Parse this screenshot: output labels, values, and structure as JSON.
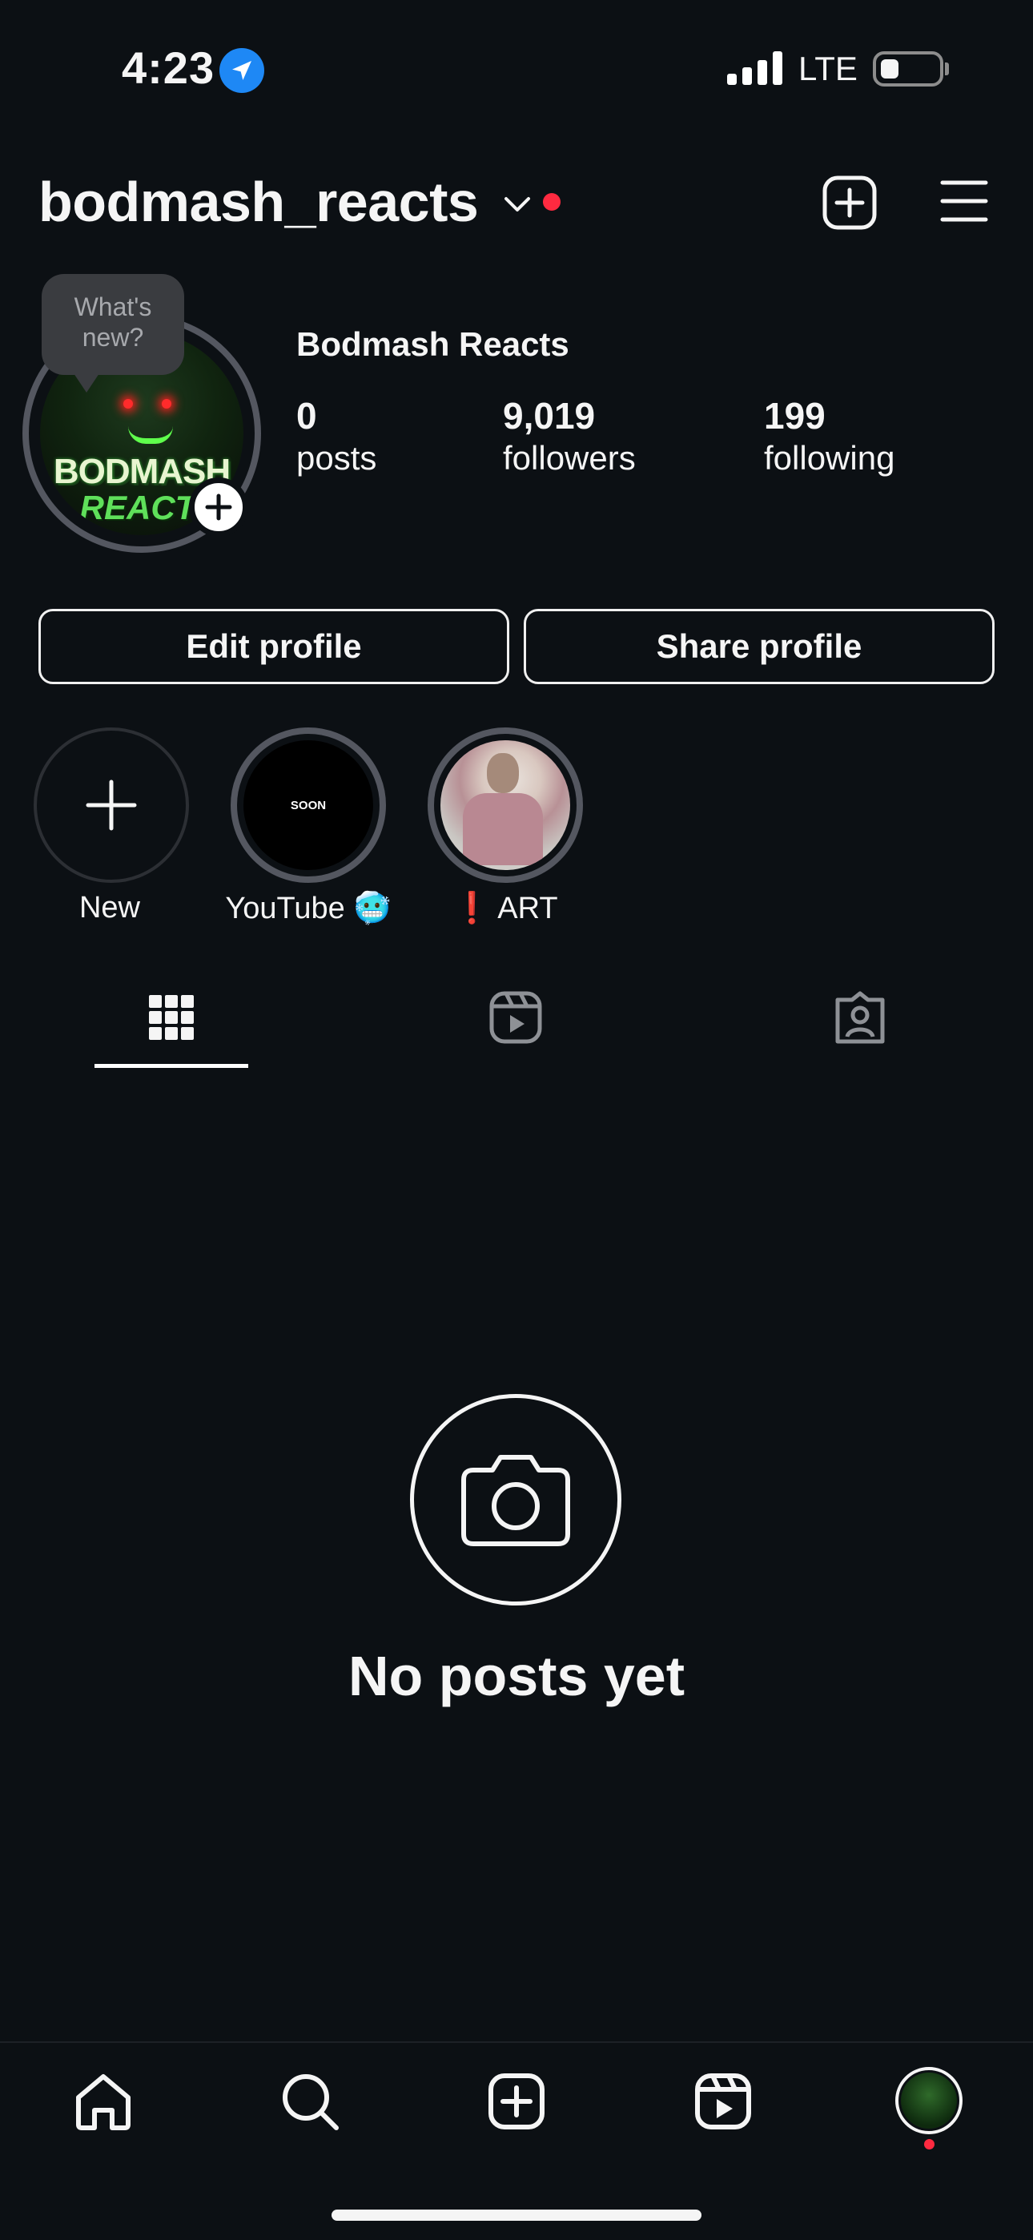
{
  "status_bar": {
    "time": "4:23",
    "network": "LTE"
  },
  "header": {
    "username": "bodmash_reacts",
    "icons": [
      "chevron-down-icon",
      "notification-dot",
      "new-post-icon",
      "menu-icon"
    ],
    "dot_color": "#ff2a40"
  },
  "profile": {
    "note_bubble": "What's new?",
    "display_name": "Bodmash Reacts",
    "avatar_text_line1": "BODMASH",
    "avatar_text_line2": "REACTS",
    "stats": [
      {
        "value": "0",
        "label": "posts"
      },
      {
        "value": "9,019",
        "label": "followers"
      },
      {
        "value": "199",
        "label": "following"
      }
    ]
  },
  "buttons": {
    "edit": "Edit profile",
    "share": "Share profile"
  },
  "highlights": [
    {
      "label": "New",
      "icon": "plus-icon"
    },
    {
      "label": "YouTube 🥶",
      "cover_text": "SOON"
    },
    {
      "label": "❗ ART"
    }
  ],
  "tabs": [
    {
      "name": "grid",
      "icon": "grid-icon",
      "active": true
    },
    {
      "name": "reels",
      "icon": "reels-icon",
      "active": false
    },
    {
      "name": "tagged",
      "icon": "tagged-icon",
      "active": false
    }
  ],
  "empty_state": {
    "icon": "camera-icon",
    "title": "No posts yet"
  },
  "bottom_nav": [
    {
      "name": "home",
      "icon": "home-icon"
    },
    {
      "name": "search",
      "icon": "search-icon"
    },
    {
      "name": "create",
      "icon": "create-icon"
    },
    {
      "name": "reels",
      "icon": "reels-icon"
    },
    {
      "name": "profile",
      "icon": "profile-avatar"
    }
  ],
  "colors": {
    "background": "#0c1014",
    "text": "#f5f5f5",
    "accent_red": "#ff2a40",
    "location_blue": "#1e88f5"
  }
}
